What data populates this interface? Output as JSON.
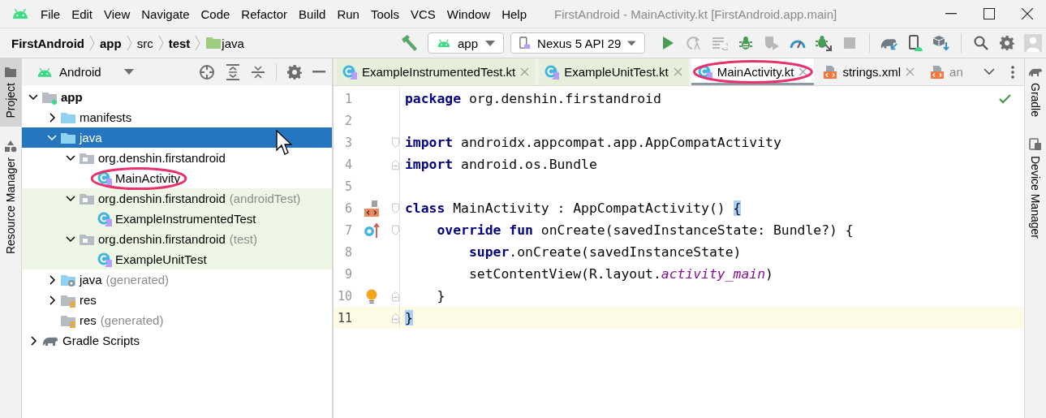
{
  "window": {
    "title": "FirstAndroid - MainActivity.kt [FirstAndroid.app.main]"
  },
  "menu": [
    {
      "label": "File"
    },
    {
      "label": "Edit"
    },
    {
      "label": "View"
    },
    {
      "label": "Navigate"
    },
    {
      "label": "Code"
    },
    {
      "label": "Refactor"
    },
    {
      "label": "Build"
    },
    {
      "label": "Run"
    },
    {
      "label": "Tools"
    },
    {
      "label": "VCS"
    },
    {
      "label": "Window"
    },
    {
      "label": "Help"
    }
  ],
  "breadcrumb": [
    {
      "label": "FirstAndroid",
      "bold": true,
      "kind": "text"
    },
    {
      "label": "app",
      "bold": true,
      "kind": "text"
    },
    {
      "label": "src",
      "bold": false,
      "kind": "text"
    },
    {
      "label": "test",
      "bold": true,
      "kind": "text"
    },
    {
      "label": "java",
      "bold": false,
      "kind": "folder"
    }
  ],
  "run_config": {
    "label": "app"
  },
  "device": {
    "label": "Nexus 5 API 29"
  },
  "toolbar_icons": [
    {
      "kind": "run",
      "disabled": false
    },
    {
      "kind": "apply-code",
      "disabled": true
    },
    {
      "kind": "apply-changes",
      "disabled": true
    },
    {
      "kind": "debug",
      "disabled": false
    },
    {
      "kind": "coverage",
      "disabled": true
    },
    {
      "kind": "profile",
      "disabled": false
    },
    {
      "kind": "attach-debugger",
      "disabled": false
    },
    {
      "kind": "stop",
      "disabled": true
    },
    {
      "kind": "sync",
      "disabled": false
    },
    {
      "kind": "device-manager",
      "disabled": false
    },
    {
      "kind": "sdk-manager",
      "disabled": false
    }
  ],
  "left_stripe": [
    {
      "label": "Project",
      "kind": "project",
      "selected": true
    },
    {
      "label": "Resource Manager",
      "kind": "resources",
      "selected": false
    }
  ],
  "right_stripe": [
    {
      "label": "Gradle",
      "kind": "gradle"
    },
    {
      "label": "Device Manager",
      "kind": "device"
    }
  ],
  "project_panel": {
    "view": "Android",
    "tree": [
      {
        "label": "app",
        "kind": "module",
        "bold": true,
        "expanded": true,
        "selected": false,
        "test": false,
        "circled": false,
        "children": [
          {
            "label": "manifests",
            "kind": "folder",
            "bold": false,
            "expanded": false,
            "selected": false,
            "test": false,
            "circled": false
          },
          {
            "label": "java",
            "kind": "folder",
            "bold": false,
            "expanded": true,
            "selected": true,
            "test": false,
            "circled": false,
            "children": [
              {
                "label": "org.denshin.firstandroid",
                "kind": "package",
                "bold": false,
                "expanded": true,
                "selected": false,
                "test": false,
                "circled": false,
                "children": [
                  {
                    "label": "MainActivity",
                    "kind": "kotlin",
                    "bold": false,
                    "selected": false,
                    "test": false,
                    "circled": true
                  }
                ]
              },
              {
                "label": "org.denshin.firstandroid",
                "suffix": "(androidTest)",
                "kind": "package",
                "bold": false,
                "expanded": true,
                "selected": false,
                "test": true,
                "circled": false,
                "children": [
                  {
                    "label": "ExampleInstrumentedTest",
                    "kind": "kotlin",
                    "bold": false,
                    "selected": false,
                    "test": true,
                    "circled": false
                  }
                ]
              },
              {
                "label": "org.denshin.firstandroid",
                "suffix": "(test)",
                "kind": "package",
                "bold": false,
                "expanded": true,
                "selected": false,
                "test": true,
                "circled": false,
                "children": [
                  {
                    "label": "ExampleUnitTest",
                    "kind": "kotlin",
                    "bold": false,
                    "selected": false,
                    "test": true,
                    "circled": false
                  }
                ]
              }
            ]
          },
          {
            "label": "java",
            "suffix": "(generated)",
            "kind": "generated",
            "bold": false,
            "expanded": false,
            "selected": false,
            "test": false,
            "circled": false
          },
          {
            "label": "res",
            "kind": "res",
            "bold": false,
            "expanded": false,
            "selected": false,
            "test": false,
            "circled": false
          },
          {
            "label": "res",
            "suffix": "(generated)",
            "kind": "res",
            "bold": false,
            "selected": false,
            "test": false,
            "circled": false
          }
        ]
      },
      {
        "label": "Gradle Scripts",
        "kind": "gradle",
        "bold": false,
        "expanded": false,
        "selected": false,
        "test": false,
        "circled": false
      }
    ]
  },
  "editor": {
    "tabs": [
      {
        "label": "ExampleInstrumentedTest.kt",
        "kind": "kotlin",
        "test": true,
        "selected": false,
        "closable": true,
        "circled": false
      },
      {
        "label": "ExampleUnitTest.kt",
        "kind": "kotlin",
        "test": true,
        "selected": false,
        "closable": true,
        "circled": false
      },
      {
        "label": "MainActivity.kt",
        "kind": "kotlin",
        "test": false,
        "selected": true,
        "closable": true,
        "circled": true
      },
      {
        "label": "strings.xml",
        "kind": "xml",
        "test": false,
        "selected": false,
        "closable": true,
        "circled": false
      },
      {
        "label": "an",
        "kind": "xml",
        "test": false,
        "selected": false,
        "closable": false,
        "circled": false
      }
    ],
    "lines": [
      {
        "number": "1",
        "kind": "plain",
        "current": false,
        "fold_start": false,
        "fold_end": false,
        "tokens": [
          {
            "text": "package",
            "kind": "keyword"
          },
          {
            "text": " org.denshin.firstandroid",
            "kind": "plain"
          }
        ]
      },
      {
        "number": "2",
        "kind": "plain",
        "current": false,
        "fold_start": false,
        "fold_end": false
      },
      {
        "number": "3",
        "kind": "plain",
        "current": false,
        "fold_start": true,
        "fold_end": false,
        "tokens": [
          {
            "text": "import",
            "kind": "keyword"
          },
          {
            "text": " androidx.appcompat.app.AppCompatActivity",
            "kind": "plain"
          }
        ]
      },
      {
        "number": "4",
        "kind": "plain",
        "current": false,
        "fold_start": false,
        "fold_end": true,
        "tokens": [
          {
            "text": "import",
            "kind": "keyword"
          },
          {
            "text": " android.os.Bundle",
            "kind": "plain"
          }
        ]
      },
      {
        "number": "5",
        "kind": "plain",
        "current": false,
        "fold_start": false,
        "fold_end": false
      },
      {
        "number": "6",
        "kind": "layout",
        "current": false,
        "fold_start": true,
        "fold_end": false,
        "tokens": [
          {
            "text": "class",
            "kind": "keyword"
          },
          {
            "text": " MainActivity : AppCompatActivity() ",
            "kind": "plain"
          },
          {
            "text": "{",
            "kind": "brace"
          }
        ]
      },
      {
        "number": "7",
        "kind": "override",
        "current": false,
        "fold_start": true,
        "fold_end": false,
        "tokens": [
          {
            "text": "    override fun",
            "kind": "keyword"
          },
          {
            "text": " onCreate(savedInstanceState: Bundle?) {",
            "kind": "plain"
          }
        ]
      },
      {
        "number": "8",
        "kind": "plain",
        "current": false,
        "fold_start": false,
        "fold_end": false,
        "tokens": [
          {
            "text": "        super",
            "kind": "keyword"
          },
          {
            "text": ".onCreate(savedInstanceState)",
            "kind": "plain"
          }
        ]
      },
      {
        "number": "9",
        "kind": "plain",
        "current": false,
        "fold_start": false,
        "fold_end": false,
        "tokens": [
          {
            "text": "        setContentView(R.layout.",
            "kind": "plain"
          },
          {
            "text": "activity_main",
            "kind": "italic"
          },
          {
            "text": ")",
            "kind": "plain"
          }
        ]
      },
      {
        "number": "10",
        "kind": "bulb",
        "current": false,
        "fold_start": false,
        "fold_end": true,
        "tokens": [
          {
            "text": "    }",
            "kind": "plain"
          }
        ]
      },
      {
        "number": "11",
        "kind": "plain",
        "current": true,
        "fold_start": false,
        "fold_end": true,
        "tokens": [
          {
            "text": "}",
            "kind": "brace"
          }
        ]
      }
    ]
  }
}
